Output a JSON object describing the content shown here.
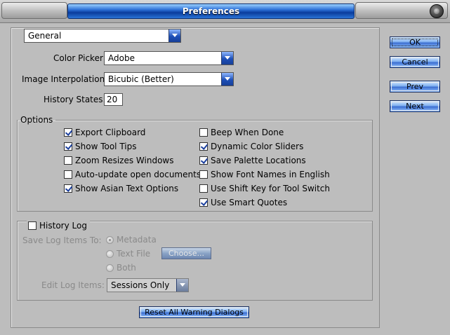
{
  "window": {
    "title": "Preferences"
  },
  "section_select": {
    "value": "General"
  },
  "general": {
    "color_picker": {
      "label": "Color Picker:",
      "value": "Adobe"
    },
    "image_interpolation": {
      "label": "Image Interpolation:",
      "value": "Bicubic (Better)"
    },
    "history_states": {
      "label": "History States:",
      "value": "20"
    }
  },
  "options": {
    "legend": "Options",
    "left": [
      {
        "label": "Export Clipboard",
        "checked": true
      },
      {
        "label": "Show Tool Tips",
        "checked": true
      },
      {
        "label": "Zoom Resizes Windows",
        "checked": false
      },
      {
        "label": "Auto-update open documents",
        "checked": false
      },
      {
        "label": "Show Asian Text Options",
        "checked": true
      }
    ],
    "right": [
      {
        "label": "Beep When Done",
        "checked": false
      },
      {
        "label": "Dynamic Color Sliders",
        "checked": true
      },
      {
        "label": "Save Palette Locations",
        "checked": true
      },
      {
        "label": "Show Font Names in English",
        "checked": false
      },
      {
        "label": "Use Shift Key for Tool Switch",
        "checked": false
      },
      {
        "label": "Use Smart Quotes",
        "checked": true
      }
    ]
  },
  "history_log": {
    "label": "History Log",
    "checked": false,
    "save_to_label": "Save Log Items To:",
    "radios": [
      {
        "label": "Metadata",
        "selected": true
      },
      {
        "label": "Text File",
        "selected": false
      },
      {
        "label": "Both",
        "selected": false
      }
    ],
    "choose_button": "Choose...",
    "edit_label": "Edit Log Items:",
    "edit_value": "Sessions Only"
  },
  "reset_button": "Reset All Warning Dialogs",
  "buttons": {
    "ok": "OK",
    "cancel": "Cancel",
    "prev": "Prev",
    "next": "Next"
  }
}
